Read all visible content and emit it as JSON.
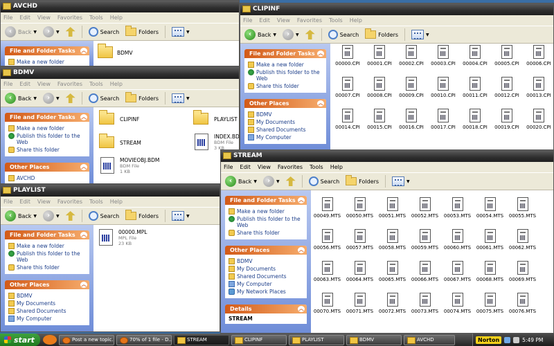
{
  "common": {
    "menu": [
      "File",
      "Edit",
      "View",
      "Favorites",
      "Tools",
      "Help"
    ],
    "back": "Back",
    "search": "Search",
    "folders": "Folders",
    "file_folder_tasks": "File and Folder Tasks",
    "other_places": "Other Places",
    "details": "Details",
    "make_folder": "Make a new folder",
    "publish": "Publish this folder to the Web",
    "share": "Share this folder"
  },
  "avchd": {
    "title": "AVCHD",
    "items": [
      "BDMV"
    ]
  },
  "clipinf": {
    "title": "CLIPINF",
    "other_places": [
      "BDMV",
      "My Documents",
      "Shared Documents",
      "My Computer"
    ],
    "files": [
      "00000.CPI",
      "00001.CPI",
      "00002.CPI",
      "00003.CPI",
      "00004.CPI",
      "00005.CPI",
      "00006.CPI",
      "00007.CPI",
      "00008.CPI",
      "00009.CPI",
      "00010.CPI",
      "00011.CPI",
      "00012.CPI",
      "00013.CPI",
      "00014.CPI",
      "00015.CPI",
      "00016.CPI",
      "00017.CPI",
      "00018.CPI",
      "00019.CPI",
      "00020.CPI"
    ]
  },
  "bdmv": {
    "title": "BDMV",
    "other_places": [
      "AVCHD"
    ],
    "folders": [
      "CLIPINF",
      "PLAYLIST",
      "STREAM"
    ],
    "files": [
      {
        "name": "INDEX.BDM",
        "type": "BDM File",
        "size": "3 KB"
      },
      {
        "name": "MOVIEOBJ.BDM",
        "type": "BDM File",
        "size": "1 KB"
      }
    ]
  },
  "playlist": {
    "title": "PLAYLIST",
    "other_places": [
      "BDMV",
      "My Documents",
      "Shared Documents",
      "My Computer"
    ],
    "files": [
      {
        "name": "00000.MPL",
        "type": "MPL File",
        "size": "23 KB"
      }
    ]
  },
  "stream": {
    "title": "STREAM",
    "other_places": [
      "BDMV",
      "My Documents",
      "Shared Documents",
      "My Computer",
      "My Network Places"
    ],
    "details_item": "STREAM",
    "files": [
      "00049.MTS",
      "00050.MTS",
      "00051.MTS",
      "00052.MTS",
      "00053.MTS",
      "00054.MTS",
      "00055.MTS",
      "00056.MTS",
      "00057.MTS",
      "00058.MTS",
      "00059.MTS",
      "00060.MTS",
      "00061.MTS",
      "00062.MTS",
      "00063.MTS",
      "00064.MTS",
      "00065.MTS",
      "00066.MTS",
      "00067.MTS",
      "00068.MTS",
      "00069.MTS",
      "00070.MTS",
      "00071.MTS",
      "00072.MTS",
      "00073.MTS",
      "00074.MTS",
      "00075.MTS",
      "00076.MTS"
    ]
  },
  "taskbar": {
    "start": "start",
    "buttons": [
      "Post a new topic...",
      "70% of 1 file - D...",
      "STREAM",
      "CLIPINF",
      "PLAYLIST",
      "BDMV",
      "AVCHD"
    ],
    "norton": "Norton",
    "clock": "5:49 PM"
  }
}
